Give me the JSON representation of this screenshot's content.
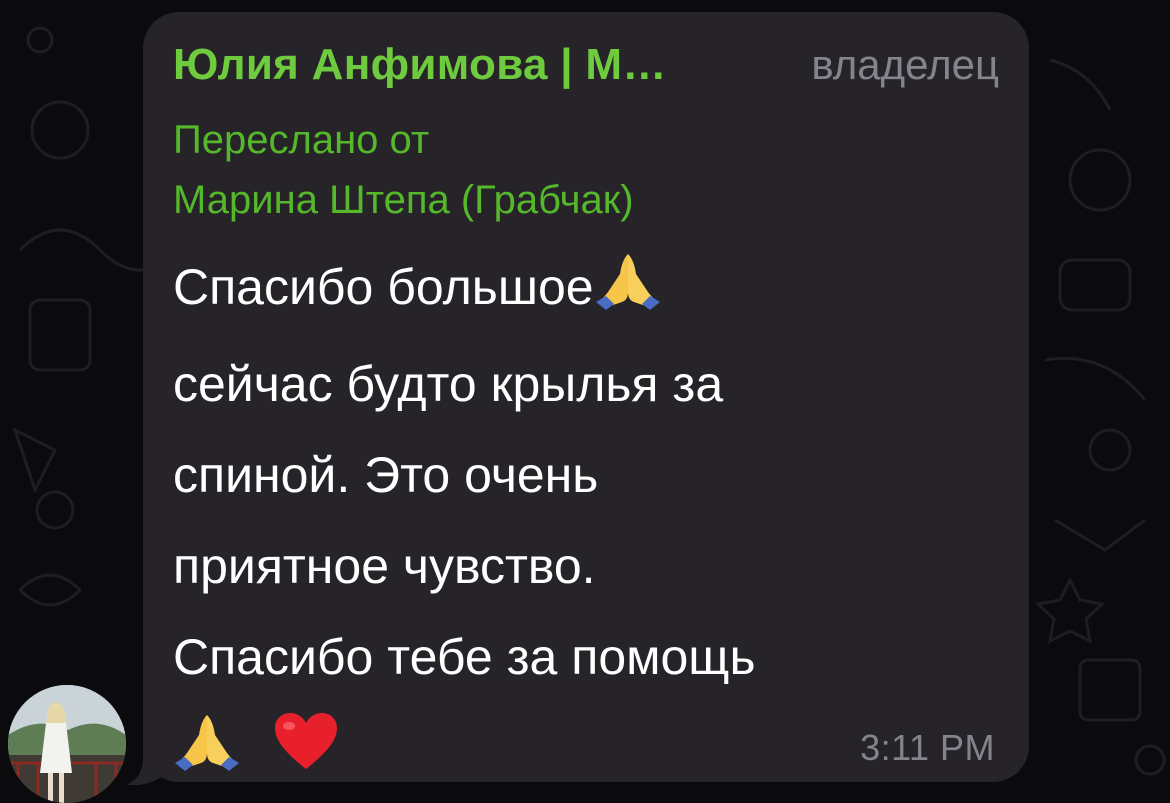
{
  "message": {
    "sender_name": "Юлия Анфимова | М…",
    "sender_role": "владелец",
    "forwarded_label": "Переслано от",
    "forwarded_from": "Марина Штепа (Грабчак)",
    "lines": [
      "Спасибо большое",
      "сейчас будто крылья за",
      "спиной. Это очень",
      "приятное чувство.",
      "Спасибо тебе за помощь"
    ],
    "time": "3:11 PM"
  },
  "icons": {
    "praying_hands": "praying-hands-emoji",
    "heart": "red-heart-emoji"
  },
  "colors": {
    "background": "#0b0b0e",
    "bubble": "#262429",
    "sender": "#6fcb3e",
    "forwarded": "#55b72a",
    "meta": "#85838c",
    "text": "#ffffff"
  }
}
